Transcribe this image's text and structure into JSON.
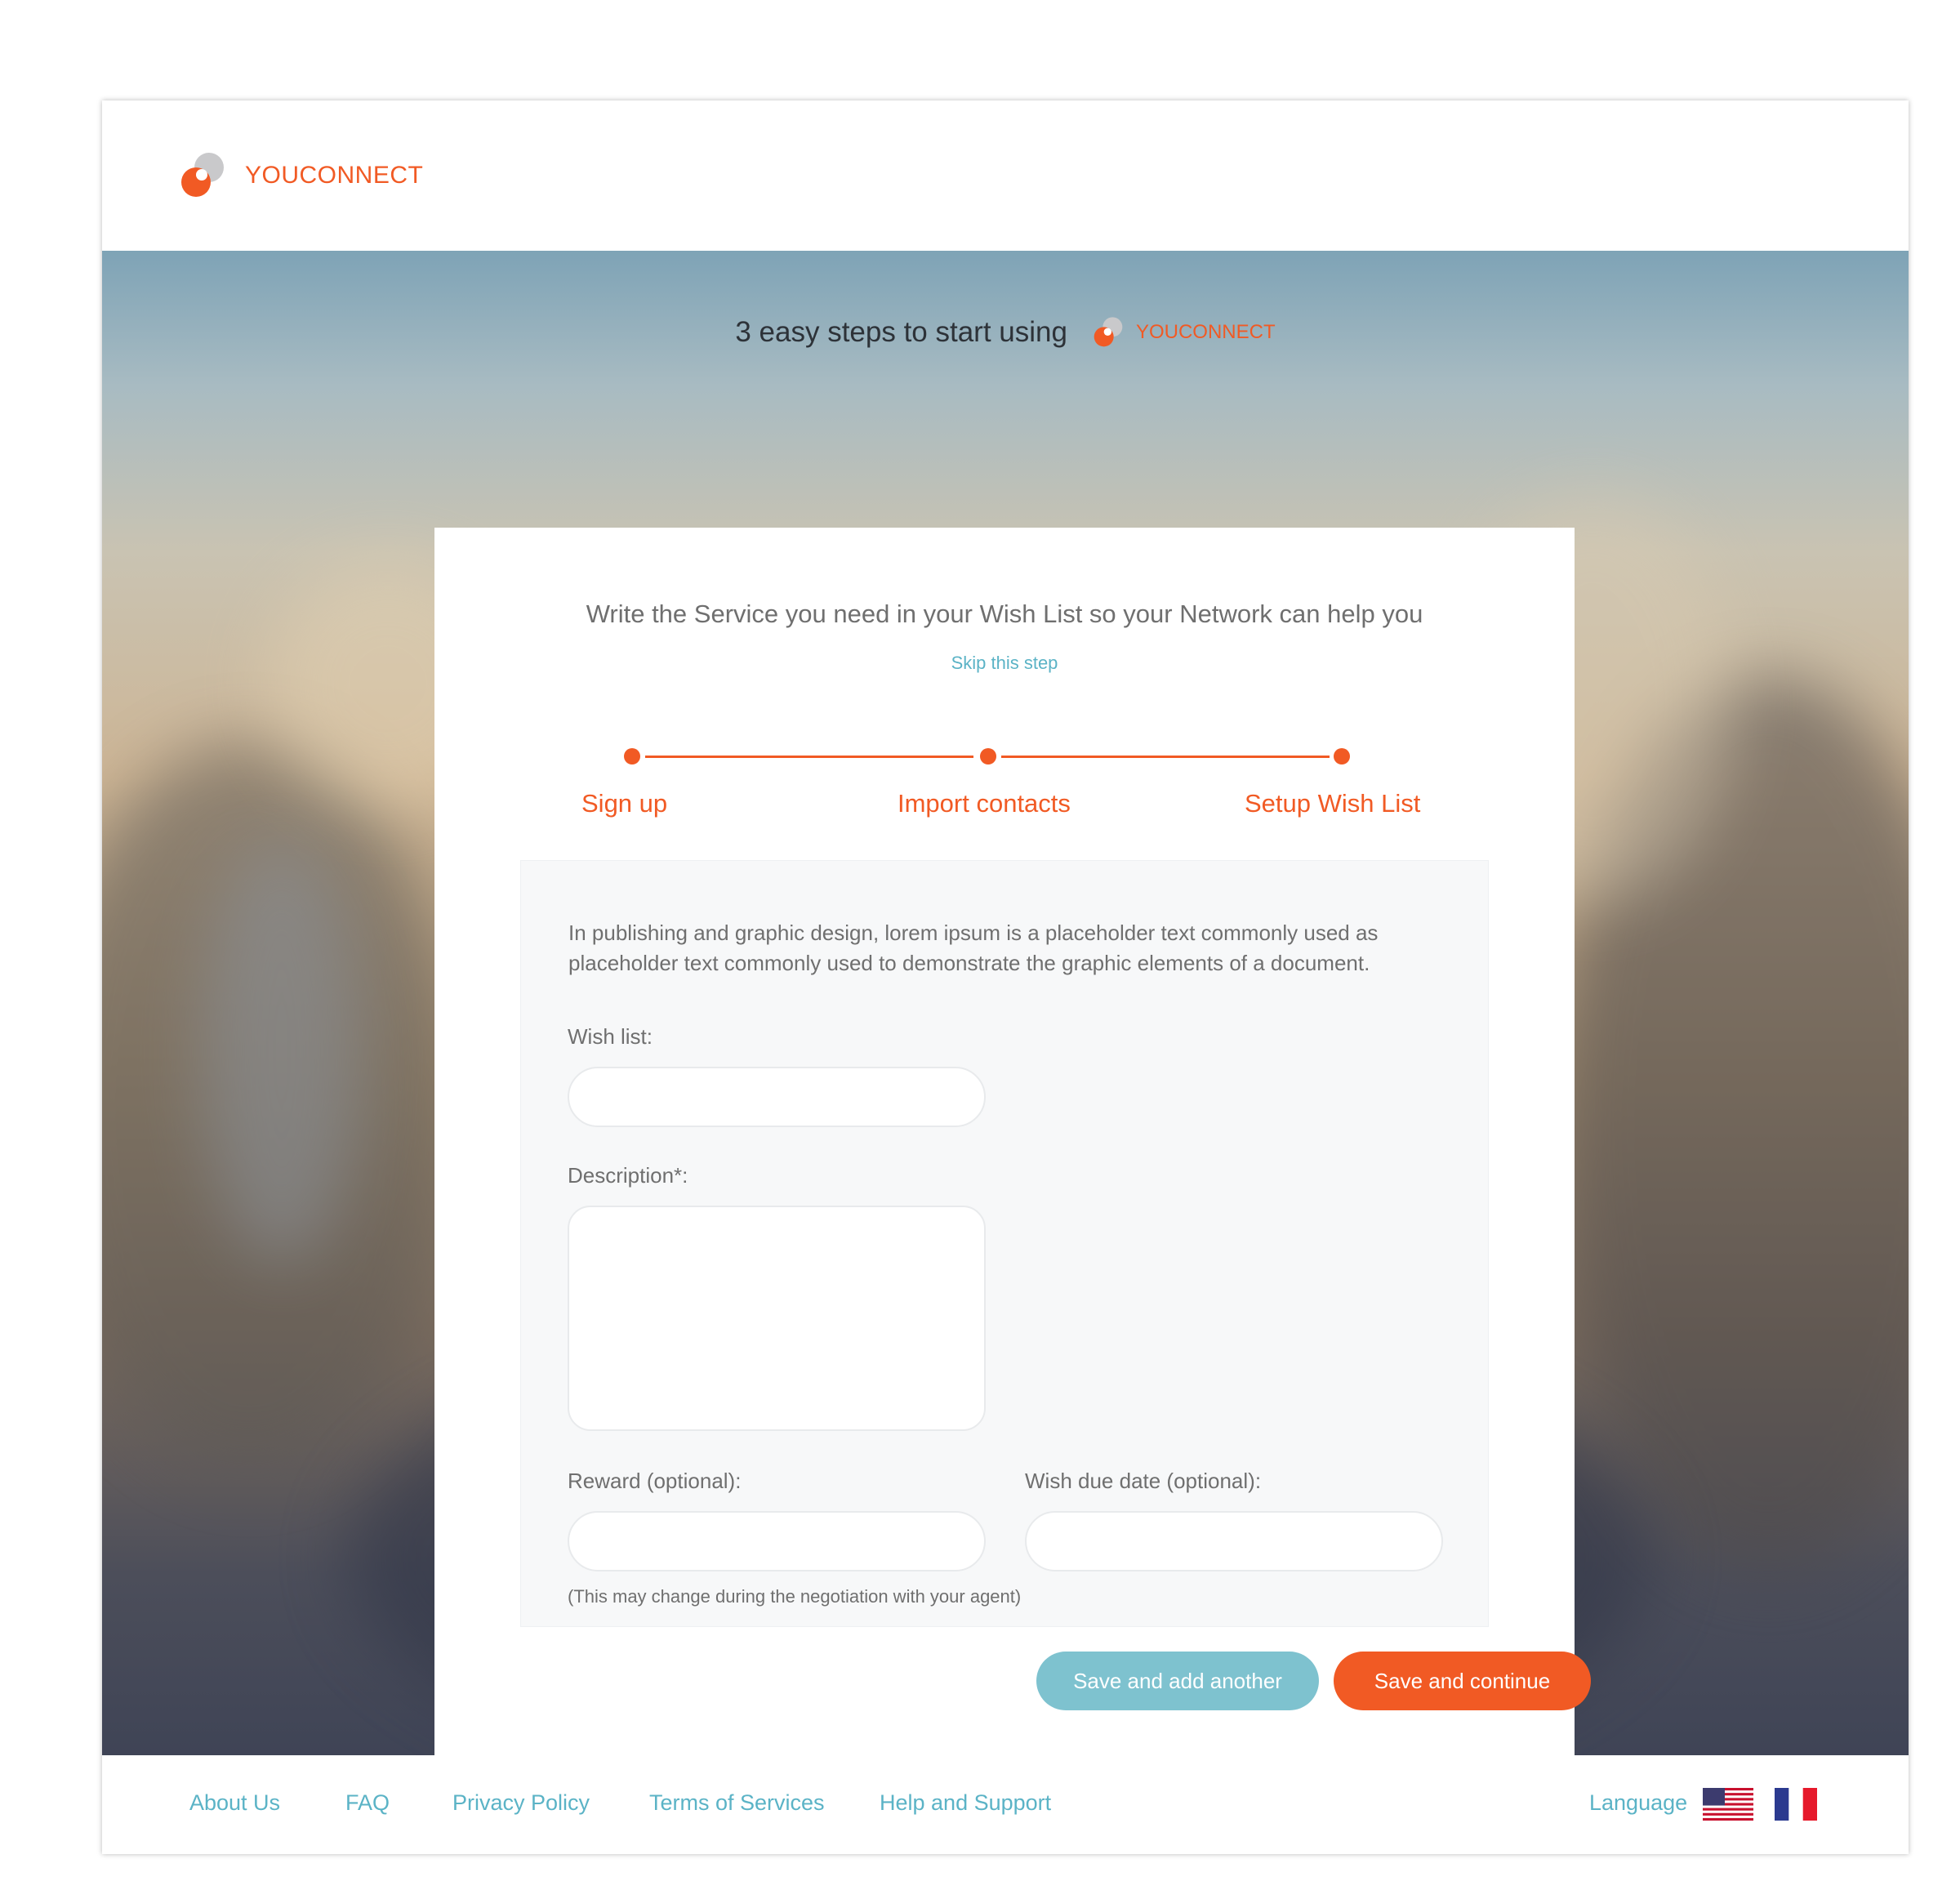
{
  "header": {
    "brand": "YOUCONNECT"
  },
  "hero": {
    "title": "3 easy steps to start using",
    "brand": "YOUCONNECT"
  },
  "card": {
    "heading": "Write the Service you need in your Wish List so your Network can help you",
    "skip_link": "Skip this step",
    "steps": [
      {
        "label": "Sign up"
      },
      {
        "label": "Import contacts"
      },
      {
        "label": "Setup Wish List"
      }
    ],
    "intro_text": "In publishing and graphic design, lorem ipsum is a placeholder text commonly used as placeholder text commonly used to demonstrate the graphic elements of a document.",
    "form": {
      "wish_list_label": "Wish list:",
      "wish_list_value": "",
      "description_label": "Description*:",
      "description_value": "",
      "reward_label": "Reward (optional):",
      "reward_value": "",
      "due_date_label": "Wish due date (optional):",
      "due_date_value": "",
      "reward_hint": "(This may change during the negotiation with your agent)"
    },
    "buttons": {
      "save_add": "Save and add another",
      "save_continue": "Save and continue"
    }
  },
  "footer": {
    "links": [
      "About Us",
      "FAQ",
      "Privacy Policy",
      "Terms of Services",
      "Help and Support"
    ],
    "language_label": "Language",
    "languages": [
      "us-flag-icon",
      "fr-flag-icon"
    ]
  },
  "colors": {
    "accent": "#f15a24",
    "link": "#5bb3c6",
    "secondary_button": "#7ec2cf"
  }
}
